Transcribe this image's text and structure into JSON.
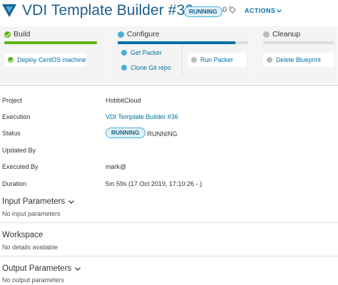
{
  "header": {
    "title": "VDI Template Builder #36",
    "status_badge": "RUNNING",
    "tag_count": "0",
    "actions_label": "ACTIONS",
    "accent_color": "#1b5e8c"
  },
  "pipeline": {
    "stages": [
      {
        "name": "Build",
        "status": "completed",
        "progress": 1.0,
        "tasks": [
          {
            "name": "Deploy CentOS machine",
            "status": "completed"
          }
        ]
      },
      {
        "name": "Configure",
        "status": "running",
        "progress": 0.9,
        "tasks": [
          {
            "name": "Get Packer",
            "status": "running"
          },
          {
            "name": "Clone Git repo",
            "status": "running"
          },
          {
            "name": "Run Packer",
            "status": "waiting"
          }
        ]
      },
      {
        "name": "Cleanup",
        "status": "waiting",
        "progress": 0,
        "tasks": [
          {
            "name": "Delete Blueprint",
            "status": "waiting"
          }
        ]
      }
    ]
  },
  "details": {
    "project_label": "Project",
    "project_value": "HobbitCloud",
    "execution_label": "Execution",
    "execution_value": "VDI Template Builder #36",
    "status_label": "Status",
    "status_badge": "RUNNING",
    "status_value": "RUNNING",
    "updated_by_label": "Updated By",
    "updated_by_value": "",
    "executed_by_label": "Executed By",
    "executed_by_value": "mark@",
    "duration_label": "Duration",
    "duration_value": "5m 59s (17 Oct 2019, 17:10:26 - )"
  },
  "sections": {
    "input_title": "Input Parameters",
    "input_empty": "No input parameters",
    "workspace_title": "Workspace",
    "workspace_empty": "No details available",
    "output_title": "Output Parameters",
    "output_empty": "No output parameters"
  },
  "colors": {
    "success": "#60b515",
    "running": "#49afd9",
    "waiting": "#bbbbbb",
    "link": "#0072a3"
  }
}
